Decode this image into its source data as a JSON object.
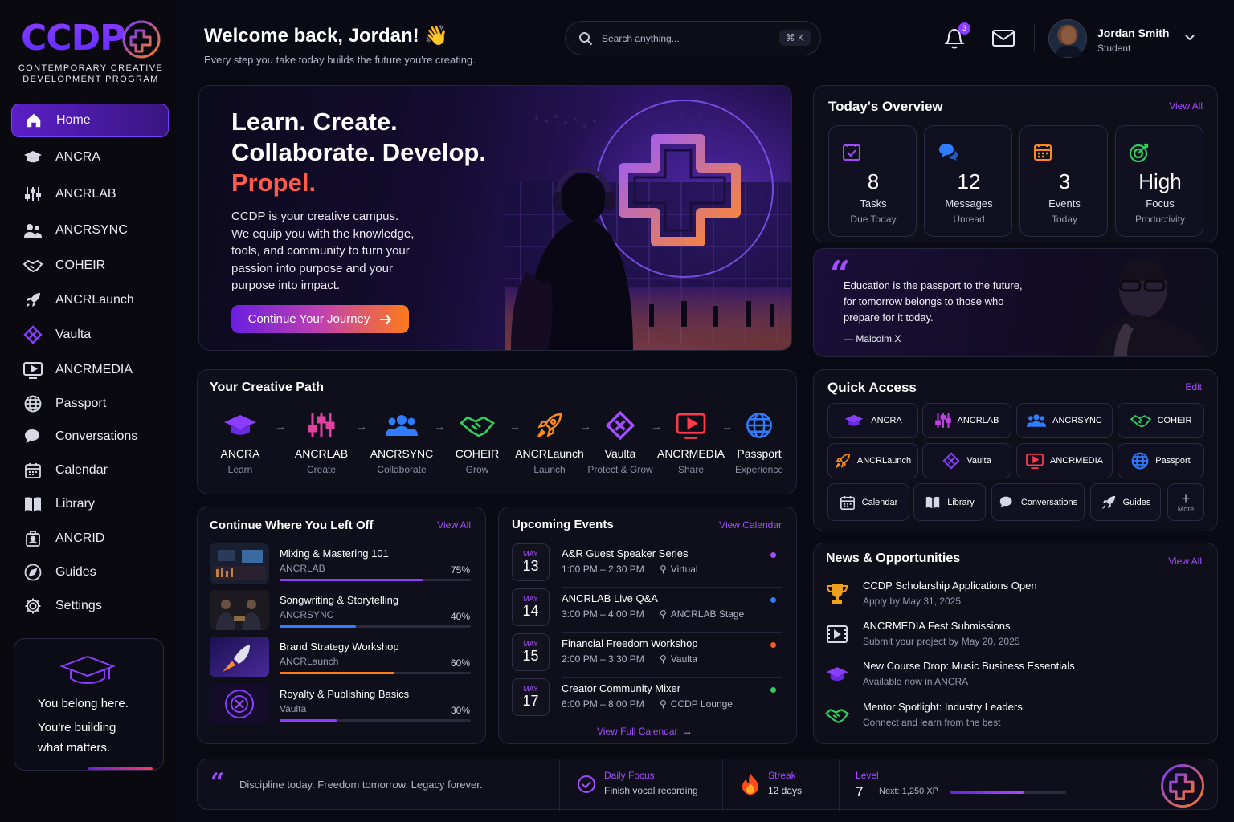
{
  "brand": {
    "logo": "CCDP",
    "subtitle_line1": "CONTEMPORARY CREATIVE",
    "subtitle_line2": "DEVELOPMENT PROGRAM"
  },
  "sidebar": {
    "items": [
      {
        "label": "Home",
        "icon": "home-icon"
      },
      {
        "label": "ANCRA",
        "icon": "graduation-cap-icon"
      },
      {
        "label": "ANCRLAB",
        "icon": "sliders-icon"
      },
      {
        "label": "ANCRSYNC",
        "icon": "users-icon"
      },
      {
        "label": "COHEIR",
        "icon": "handshake-icon"
      },
      {
        "label": "ANCRLaunch",
        "icon": "rocket-icon"
      },
      {
        "label": "Vaulta",
        "icon": "diamond-x-icon"
      },
      {
        "label": "ANCRMEDIA",
        "icon": "play-screen-icon"
      },
      {
        "label": "Passport",
        "icon": "globe-icon"
      },
      {
        "label": "Conversations",
        "icon": "chat-icon"
      },
      {
        "label": "Calendar",
        "icon": "calendar-icon"
      },
      {
        "label": "Library",
        "icon": "book-icon"
      },
      {
        "label": "ANCRID",
        "icon": "id-badge-icon"
      },
      {
        "label": "Guides",
        "icon": "compass-icon"
      },
      {
        "label": "Settings",
        "icon": "gear-icon"
      }
    ],
    "belong": {
      "line1": "You belong here.",
      "line2": "You're building",
      "line3": "what matters."
    }
  },
  "header": {
    "greeting": "Welcome back, Jordan! 👋",
    "subtitle": "Every step you take today builds the future you're creating.",
    "search_placeholder": "Search anything...",
    "search_shortcut": "⌘ K",
    "notif_count": "3",
    "user_name": "Jordan Smith",
    "user_role": "Student"
  },
  "hero": {
    "line1": "Learn. Create.",
    "line2": "Collaborate. Develop.",
    "line3": "Propel.",
    "body_1": "CCDP is your creative campus.",
    "body_2": "We equip you with the knowledge,",
    "body_3": "tools, and community to turn your",
    "body_4": "passion into purpose and your",
    "body_5": "purpose into impact.",
    "cta": "Continue Your Journey"
  },
  "overview": {
    "title": "Today's Overview",
    "link": "View All",
    "tiles": [
      {
        "value": "8",
        "label": "Tasks",
        "sub": "Due Today",
        "color": "#a44dff"
      },
      {
        "value": "12",
        "label": "Messages",
        "sub": "Unread",
        "color": "#2f7cff"
      },
      {
        "value": "3",
        "label": "Events",
        "sub": "Today",
        "color": "#ff8a1a"
      },
      {
        "value": "High",
        "label": "Focus",
        "sub": "Productivity",
        "color": "#2fd05a"
      }
    ]
  },
  "quote": {
    "line1": "Education is the passport to the future,",
    "line2": "for tomorrow belongs to those who",
    "line3": "prepare for it today.",
    "author": "— Malcolm X"
  },
  "path": {
    "title": "Your Creative Path",
    "steps": [
      {
        "name": "ANCRA",
        "sub": "Learn"
      },
      {
        "name": "ANCRLAB",
        "sub": "Create"
      },
      {
        "name": "ANCRSYNC",
        "sub": "Collaborate"
      },
      {
        "name": "COHEIR",
        "sub": "Grow"
      },
      {
        "name": "ANCRLaunch",
        "sub": "Launch"
      },
      {
        "name": "Vaulta",
        "sub": "Protect & Grow"
      },
      {
        "name": "ANCRMEDIA",
        "sub": "Share"
      },
      {
        "name": "Passport",
        "sub": "Experience"
      }
    ]
  },
  "quick": {
    "title": "Quick Access",
    "link": "Edit",
    "items": [
      "ANCRA",
      "ANCRLAB",
      "ANCRSYNC",
      "COHEIR",
      "ANCRLaunch",
      "Vaulta",
      "ANCRMEDIA",
      "Passport",
      "Calendar",
      "Library",
      "Conversations",
      "Guides",
      "More"
    ]
  },
  "continue": {
    "title": "Continue Where You Left Off",
    "link": "View All",
    "courses": [
      {
        "title": "Mixing & Mastering 101",
        "module": "ANCRLAB",
        "percent": "75%",
        "progress": 0.75,
        "color": "#8a3dff"
      },
      {
        "title": "Songwriting & Storytelling",
        "module": "ANCRSYNC",
        "percent": "40%",
        "progress": 0.4,
        "color": "#2f7cff"
      },
      {
        "title": "Brand Strategy Workshop",
        "module": "ANCRLaunch",
        "percent": "60%",
        "progress": 0.6,
        "color": "#ff7a1a"
      },
      {
        "title": "Royalty & Publishing Basics",
        "module": "Vaulta",
        "percent": "30%",
        "progress": 0.3,
        "color": "#8a3dff"
      }
    ]
  },
  "events": {
    "title": "Upcoming Events",
    "link": "View Calendar",
    "footer": "View Full Calendar",
    "items": [
      {
        "month": "MAY",
        "day": "13",
        "title": "A&R Guest Speaker Series",
        "time": "1:00 PM – 2:30 PM",
        "place": "Virtual",
        "dot": "#a44dff"
      },
      {
        "month": "MAY",
        "day": "14",
        "title": "ANCRLAB Live Q&A",
        "time": "3:00 PM – 4:00 PM",
        "place": "ANCRLAB Stage",
        "dot": "#2f7cff"
      },
      {
        "month": "MAY",
        "day": "15",
        "title": "Financial Freedom Workshop",
        "time": "2:00 PM – 3:30 PM",
        "place": "Vaulta",
        "dot": "#ff5a1a"
      },
      {
        "month": "MAY",
        "day": "17",
        "title": "Creator Community Mixer",
        "time": "6:00 PM – 8:00 PM",
        "place": "CCDP Lounge",
        "dot": "#2fd05a"
      }
    ]
  },
  "news": {
    "title": "News & Opportunities",
    "link": "View All",
    "items": [
      {
        "title": "CCDP Scholarship Applications Open",
        "sub": "Apply by May 31, 2025"
      },
      {
        "title": "ANCRMEDIA Fest Submissions",
        "sub": "Submit your project by May 20, 2025"
      },
      {
        "title": "New Course Drop: Music Business Essentials",
        "sub": "Available now in ANCRA"
      },
      {
        "title": "Mentor Spotlight: Industry Leaders",
        "sub": "Connect and learn from the best"
      }
    ]
  },
  "footer": {
    "quote": "Discipline today. Freedom tomorrow. Legacy forever.",
    "focus_label": "Daily Focus",
    "focus_value": "Finish vocal recording",
    "streak_label": "Streak",
    "streak_value": "12 days",
    "level_label": "Level",
    "level_value": "7",
    "xp": "Next: 1,250 XP",
    "xp_progress": 0.63
  }
}
